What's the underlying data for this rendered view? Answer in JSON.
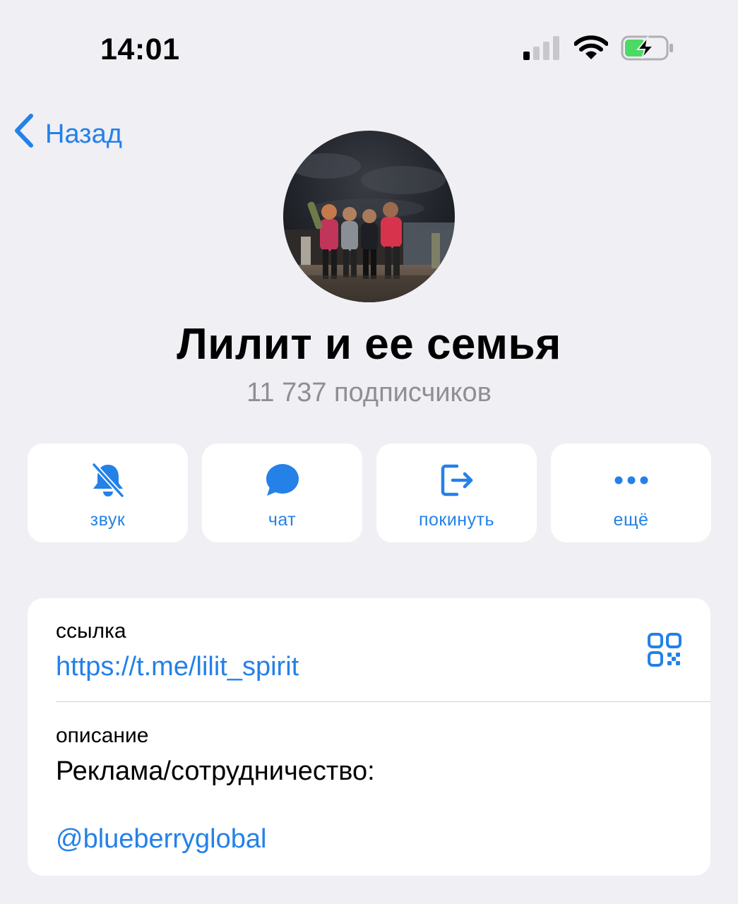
{
  "status_bar": {
    "time": "14:01",
    "signal_icon": "cellular-signal-icon",
    "wifi_icon": "wifi-icon",
    "battery_icon": "battery-charging-icon"
  },
  "nav": {
    "back_label": "Назад",
    "back_icon": "chevron-left-icon"
  },
  "channel": {
    "title": "Лилит и ее семья",
    "subscribers": "11 737 подписчиков"
  },
  "actions": [
    {
      "label": "звук",
      "icon": "bell-slash-icon"
    },
    {
      "label": "чат",
      "icon": "chat-bubble-icon"
    },
    {
      "label": "покинуть",
      "icon": "leave-icon"
    },
    {
      "label": "ещё",
      "icon": "more-icon"
    }
  ],
  "info": {
    "link_label": "ссылка",
    "link_value": "https://t.me/lilit_spirit",
    "qr_icon": "qr-code-icon",
    "description_label": "описание",
    "description_text": "Реклама/сотрудничество:",
    "description_link": "@blueberryglobal"
  },
  "colors": {
    "accent": "#2481e8",
    "background": "#efeff4",
    "secondary_text": "#8e8e93"
  }
}
